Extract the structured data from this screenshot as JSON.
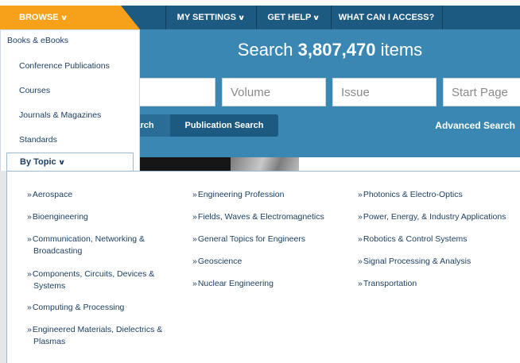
{
  "nav": {
    "browse": "BROWSE",
    "my_settings": "MY SETTINGS",
    "get_help": "GET HELP",
    "what_can_i_access": "WHAT CAN I ACCESS?"
  },
  "search": {
    "prefix": "Search ",
    "count": "3,807,470",
    "suffix": " items",
    "volume_placeholder": "Volume",
    "issue_placeholder": "Issue",
    "start_page_placeholder": "Start Page",
    "tab_partial": "arch",
    "tab_publication": "Publication Search",
    "advanced": "Advanced Search"
  },
  "browse_menu": {
    "items": [
      "Books & eBooks",
      "Conference Publications",
      "Courses",
      "Journals & Magazines",
      "Standards"
    ],
    "by_topic": "By Topic"
  },
  "topics": {
    "marker": "»",
    "col1": [
      [
        "Aerospace",
        ""
      ],
      [
        "Bioengineering",
        ""
      ],
      [
        "Communication, Networking &",
        "Broadcasting"
      ],
      [
        "Components, Circuits, Devices &",
        "Systems"
      ],
      [
        "Computing & Processing",
        ""
      ],
      [
        "Engineered Materials, Dielectrics &",
        "Plasmas"
      ]
    ],
    "col2": [
      "Engineering Profession",
      "Fields, Waves & Electromagnetics",
      "General Topics for Engineers",
      "Geoscience",
      "Nuclear Engineering"
    ],
    "col3": [
      "Photonics & Electro-Optics",
      "Power, Energy, & Industry Applications",
      "Robotics & Control Systems",
      "Signal Processing & Analysis",
      "Transportation"
    ]
  },
  "icons": {
    "chevron": "chevron-down-icon",
    "marker": "double-chevron-right-icon"
  },
  "colors": {
    "nav_bg": "#1d5a82",
    "browse_tab": "#f7a11a",
    "hero_bg": "#3a87b3",
    "link": "#1c3f62"
  }
}
